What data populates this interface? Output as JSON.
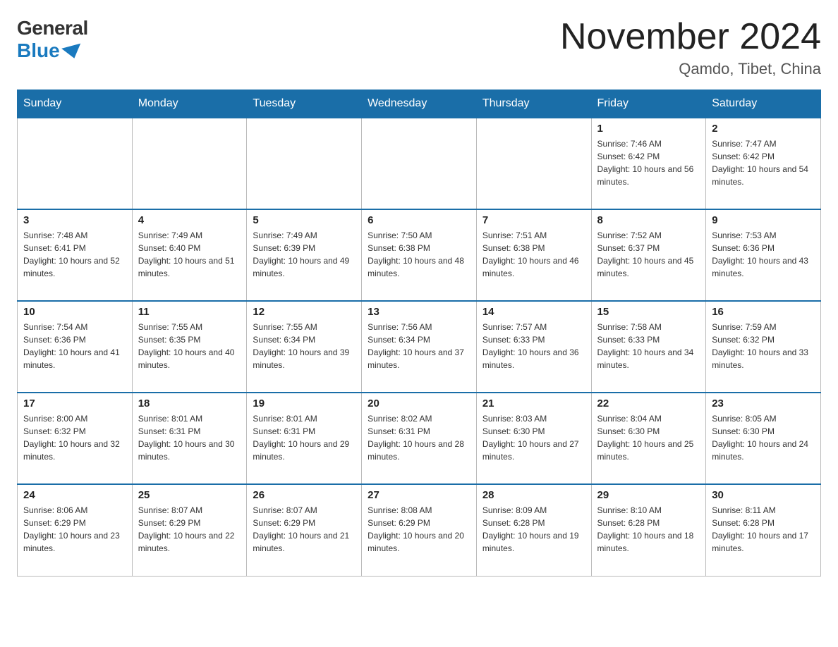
{
  "logo": {
    "general": "General",
    "blue": "Blue"
  },
  "header": {
    "month_title": "November 2024",
    "location": "Qamdo, Tibet, China"
  },
  "weekdays": [
    "Sunday",
    "Monday",
    "Tuesday",
    "Wednesday",
    "Thursday",
    "Friday",
    "Saturday"
  ],
  "weeks": [
    [
      {
        "day": "",
        "info": ""
      },
      {
        "day": "",
        "info": ""
      },
      {
        "day": "",
        "info": ""
      },
      {
        "day": "",
        "info": ""
      },
      {
        "day": "",
        "info": ""
      },
      {
        "day": "1",
        "info": "Sunrise: 7:46 AM\nSunset: 6:42 PM\nDaylight: 10 hours and 56 minutes."
      },
      {
        "day": "2",
        "info": "Sunrise: 7:47 AM\nSunset: 6:42 PM\nDaylight: 10 hours and 54 minutes."
      }
    ],
    [
      {
        "day": "3",
        "info": "Sunrise: 7:48 AM\nSunset: 6:41 PM\nDaylight: 10 hours and 52 minutes."
      },
      {
        "day": "4",
        "info": "Sunrise: 7:49 AM\nSunset: 6:40 PM\nDaylight: 10 hours and 51 minutes."
      },
      {
        "day": "5",
        "info": "Sunrise: 7:49 AM\nSunset: 6:39 PM\nDaylight: 10 hours and 49 minutes."
      },
      {
        "day": "6",
        "info": "Sunrise: 7:50 AM\nSunset: 6:38 PM\nDaylight: 10 hours and 48 minutes."
      },
      {
        "day": "7",
        "info": "Sunrise: 7:51 AM\nSunset: 6:38 PM\nDaylight: 10 hours and 46 minutes."
      },
      {
        "day": "8",
        "info": "Sunrise: 7:52 AM\nSunset: 6:37 PM\nDaylight: 10 hours and 45 minutes."
      },
      {
        "day": "9",
        "info": "Sunrise: 7:53 AM\nSunset: 6:36 PM\nDaylight: 10 hours and 43 minutes."
      }
    ],
    [
      {
        "day": "10",
        "info": "Sunrise: 7:54 AM\nSunset: 6:36 PM\nDaylight: 10 hours and 41 minutes."
      },
      {
        "day": "11",
        "info": "Sunrise: 7:55 AM\nSunset: 6:35 PM\nDaylight: 10 hours and 40 minutes."
      },
      {
        "day": "12",
        "info": "Sunrise: 7:55 AM\nSunset: 6:34 PM\nDaylight: 10 hours and 39 minutes."
      },
      {
        "day": "13",
        "info": "Sunrise: 7:56 AM\nSunset: 6:34 PM\nDaylight: 10 hours and 37 minutes."
      },
      {
        "day": "14",
        "info": "Sunrise: 7:57 AM\nSunset: 6:33 PM\nDaylight: 10 hours and 36 minutes."
      },
      {
        "day": "15",
        "info": "Sunrise: 7:58 AM\nSunset: 6:33 PM\nDaylight: 10 hours and 34 minutes."
      },
      {
        "day": "16",
        "info": "Sunrise: 7:59 AM\nSunset: 6:32 PM\nDaylight: 10 hours and 33 minutes."
      }
    ],
    [
      {
        "day": "17",
        "info": "Sunrise: 8:00 AM\nSunset: 6:32 PM\nDaylight: 10 hours and 32 minutes."
      },
      {
        "day": "18",
        "info": "Sunrise: 8:01 AM\nSunset: 6:31 PM\nDaylight: 10 hours and 30 minutes."
      },
      {
        "day": "19",
        "info": "Sunrise: 8:01 AM\nSunset: 6:31 PM\nDaylight: 10 hours and 29 minutes."
      },
      {
        "day": "20",
        "info": "Sunrise: 8:02 AM\nSunset: 6:31 PM\nDaylight: 10 hours and 28 minutes."
      },
      {
        "day": "21",
        "info": "Sunrise: 8:03 AM\nSunset: 6:30 PM\nDaylight: 10 hours and 27 minutes."
      },
      {
        "day": "22",
        "info": "Sunrise: 8:04 AM\nSunset: 6:30 PM\nDaylight: 10 hours and 25 minutes."
      },
      {
        "day": "23",
        "info": "Sunrise: 8:05 AM\nSunset: 6:30 PM\nDaylight: 10 hours and 24 minutes."
      }
    ],
    [
      {
        "day": "24",
        "info": "Sunrise: 8:06 AM\nSunset: 6:29 PM\nDaylight: 10 hours and 23 minutes."
      },
      {
        "day": "25",
        "info": "Sunrise: 8:07 AM\nSunset: 6:29 PM\nDaylight: 10 hours and 22 minutes."
      },
      {
        "day": "26",
        "info": "Sunrise: 8:07 AM\nSunset: 6:29 PM\nDaylight: 10 hours and 21 minutes."
      },
      {
        "day": "27",
        "info": "Sunrise: 8:08 AM\nSunset: 6:29 PM\nDaylight: 10 hours and 20 minutes."
      },
      {
        "day": "28",
        "info": "Sunrise: 8:09 AM\nSunset: 6:28 PM\nDaylight: 10 hours and 19 minutes."
      },
      {
        "day": "29",
        "info": "Sunrise: 8:10 AM\nSunset: 6:28 PM\nDaylight: 10 hours and 18 minutes."
      },
      {
        "day": "30",
        "info": "Sunrise: 8:11 AM\nSunset: 6:28 PM\nDaylight: 10 hours and 17 minutes."
      }
    ]
  ]
}
